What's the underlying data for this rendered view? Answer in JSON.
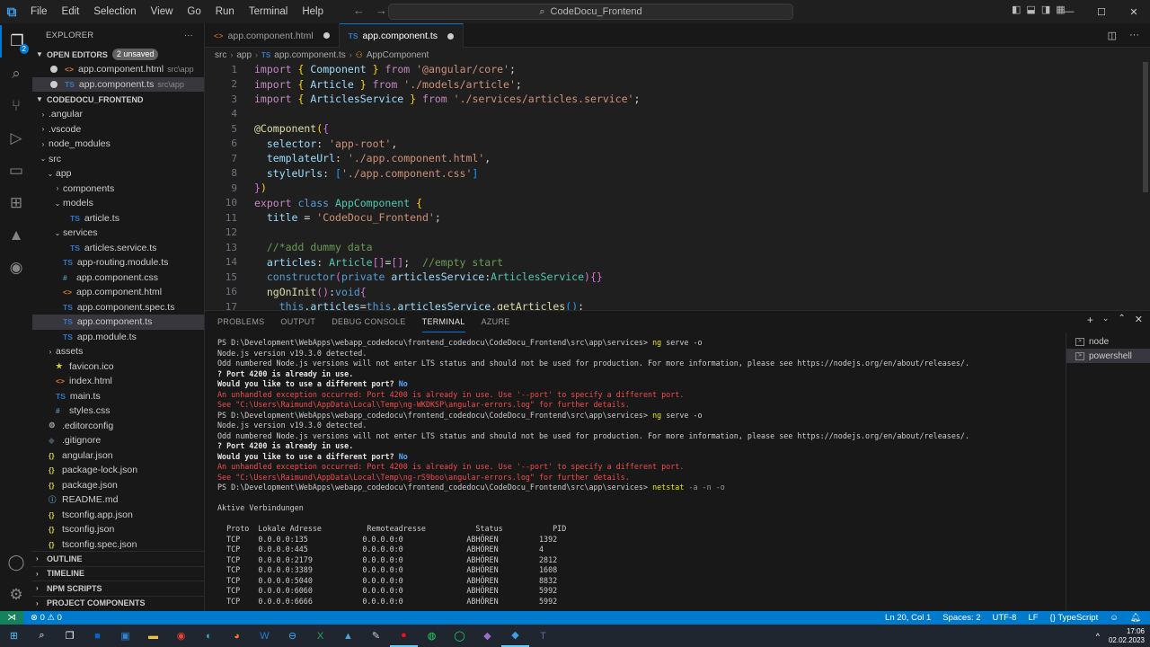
{
  "titlebar": {
    "menu": [
      "File",
      "Edit",
      "Selection",
      "View",
      "Go",
      "Run",
      "Terminal",
      "Help"
    ],
    "search": "CodeDocu_Frontend"
  },
  "explorer": {
    "title": "EXPLORER",
    "open_editors": {
      "label": "OPEN EDITORS",
      "badge": "2 unsaved",
      "items": [
        {
          "name": "app.component.html",
          "path": "src\\app",
          "icon": "html"
        },
        {
          "name": "app.component.ts",
          "path": "src\\app",
          "icon": "ts"
        }
      ]
    },
    "project": {
      "label": "CODEDOCU_FRONTEND",
      "tree": [
        {
          "name": ".angular",
          "depth": 0,
          "folder": true
        },
        {
          "name": ".vscode",
          "depth": 0,
          "folder": true
        },
        {
          "name": "node_modules",
          "depth": 0,
          "folder": true
        },
        {
          "name": "src",
          "depth": 0,
          "folder": true,
          "open": true
        },
        {
          "name": "app",
          "depth": 1,
          "folder": true,
          "open": true
        },
        {
          "name": "components",
          "depth": 2,
          "folder": true
        },
        {
          "name": "models",
          "depth": 2,
          "folder": true,
          "open": true
        },
        {
          "name": "article.ts",
          "depth": 3,
          "icon": "ts"
        },
        {
          "name": "services",
          "depth": 2,
          "folder": true,
          "open": true
        },
        {
          "name": "articles.service.ts",
          "depth": 3,
          "icon": "ts"
        },
        {
          "name": "app-routing.module.ts",
          "depth": 2,
          "icon": "ts"
        },
        {
          "name": "app.component.css",
          "depth": 2,
          "icon": "css"
        },
        {
          "name": "app.component.html",
          "depth": 2,
          "icon": "html"
        },
        {
          "name": "app.component.spec.ts",
          "depth": 2,
          "icon": "ts"
        },
        {
          "name": "app.component.ts",
          "depth": 2,
          "icon": "ts",
          "selected": true
        },
        {
          "name": "app.module.ts",
          "depth": 2,
          "icon": "ts"
        },
        {
          "name": "assets",
          "depth": 1,
          "folder": true
        },
        {
          "name": "favicon.ico",
          "depth": 1,
          "icon": "fav"
        },
        {
          "name": "index.html",
          "depth": 1,
          "icon": "html"
        },
        {
          "name": "main.ts",
          "depth": 1,
          "icon": "ts"
        },
        {
          "name": "styles.css",
          "depth": 1,
          "icon": "css"
        },
        {
          "name": ".editorconfig",
          "depth": 0,
          "icon": "cfg"
        },
        {
          "name": ".gitignore",
          "depth": 0,
          "icon": "git"
        },
        {
          "name": "angular.json",
          "depth": 0,
          "icon": "json"
        },
        {
          "name": "package-lock.json",
          "depth": 0,
          "icon": "json"
        },
        {
          "name": "package.json",
          "depth": 0,
          "icon": "json"
        },
        {
          "name": "README.md",
          "depth": 0,
          "icon": "md"
        },
        {
          "name": "tsconfig.app.json",
          "depth": 0,
          "icon": "json"
        },
        {
          "name": "tsconfig.json",
          "depth": 0,
          "icon": "json"
        },
        {
          "name": "tsconfig.spec.json",
          "depth": 0,
          "icon": "json"
        }
      ]
    },
    "bottom_sections": [
      "OUTLINE",
      "TIMELINE",
      "NPM SCRIPTS",
      "PROJECT COMPONENTS"
    ]
  },
  "tabs": [
    {
      "label": "app.component.html",
      "icon": "html",
      "active": false
    },
    {
      "label": "app.component.ts",
      "icon": "ts",
      "active": true
    }
  ],
  "breadcrumb": [
    "src",
    "app",
    "app.component.ts",
    "AppComponent"
  ],
  "code_lines": [
    "1",
    "2",
    "3",
    "4",
    "5",
    "6",
    "7",
    "8",
    "9",
    "10",
    "11",
    "12",
    "13",
    "14",
    "15",
    "16",
    "17"
  ],
  "code": {
    "l1": {
      "import": "import",
      "names": "Component",
      "from": "from",
      "str": "'@angular/core'"
    },
    "l2": {
      "import": "import",
      "names": "Article",
      "from": "from",
      "str": "'./models/article'"
    },
    "l3": {
      "import": "import",
      "names": "ArticlesService",
      "from": "from",
      "str": "'./services/articles.service'"
    },
    "l5": {
      "decorator": "@Component"
    },
    "l6": {
      "key": "selector",
      "str": "'app-root'"
    },
    "l7": {
      "key": "templateUrl",
      "str": "'./app.component.html'"
    },
    "l8": {
      "key": "styleUrls",
      "str": "'./app.component.css'"
    },
    "l10": {
      "export": "export",
      "class": "class",
      "name": "AppComponent"
    },
    "l11": {
      "key": "title",
      "str": "'CodeDocu_Frontend'"
    },
    "l13": {
      "comment": "//*add dummy data"
    },
    "l14": {
      "key": "articles",
      "type": "Article",
      "comment": "//empty start"
    },
    "l15": {
      "ctor": "constructor",
      "private": "private",
      "param": "articlesService",
      "type": "ArticlesService"
    },
    "l16": {
      "fn": "ngOnInit",
      "ret": "void"
    },
    "l17": {
      "this1": "this",
      "prop": "articles",
      "this2": "this",
      "svc": "articlesService",
      "call": "getArticles"
    }
  },
  "panel": {
    "tabs": [
      "PROBLEMS",
      "OUTPUT",
      "DEBUG CONSOLE",
      "TERMINAL",
      "AZURE"
    ],
    "active_tab": "TERMINAL",
    "terminals": [
      "node",
      "powershell"
    ]
  },
  "terminal": {
    "prompt": "PS D:\\Development\\WebApps\\webapp_codedocu\\frontend_codedocu\\CodeDocu_Frontend\\src\\app\\services>",
    "cmd_ng": "ng",
    "cmd_serve": "serve -o",
    "node_version": "Node.js version v19.3.0 detected.",
    "odd_warning": "Odd numbered Node.js versions will not enter LTS status and should not be used for production. For more information, please see https://nodejs.org/en/about/releases/.",
    "port_in_use": "? Port 4200 is already in use.",
    "different_port": "Would you like to use a different port?",
    "answer_no": "No",
    "exception": "An unhandled exception occurred: Port 4200 is already in use. Use '--port' to specify a different port.",
    "see_log1": "See \"C:\\Users\\Raimund\\AppData\\Local\\Temp\\ng-WKDKSP\\angular-errors.log\" for further details.",
    "see_log2": "See \"C:\\Users\\Raimund\\AppData\\Local\\Temp\\ng-rS9boo\\angular-errors.log\" for further details.",
    "cmd_netstat": "netstat",
    "netstat_args": "-a -n -o",
    "aktive": "Aktive Verbindungen",
    "table_header": "  Proto  Lokale Adresse          Remoteadresse           Status           PID",
    "table_rows": [
      "  TCP    0.0.0.0:135            0.0.0.0:0              ABHÖREN         1392",
      "  TCP    0.0.0.0:445            0.0.0.0:0              ABHÖREN         4",
      "  TCP    0.0.0.0:2179           0.0.0.0:0              ABHÖREN         2812",
      "  TCP    0.0.0.0:3389           0.0.0.0:0              ABHÖREN         1608",
      "  TCP    0.0.0.0:5040           0.0.0.0:0              ABHÖREN         8832",
      "  TCP    0.0.0.0:6060           0.0.0.0:0              ABHÖREN         5992",
      "  TCP    0.0.0.0:6666           0.0.0.0:0              ABHÖREN         5992"
    ]
  },
  "statusbar": {
    "errors": "⊗ 0 ⚠ 0",
    "position": "Ln 20, Col 1",
    "spaces": "Spaces: 2",
    "encoding": "UTF-8",
    "eol": "LF",
    "language": "{} TypeScript"
  },
  "clock": {
    "time": "17:06",
    "date": "02.02.2023"
  },
  "colors": {
    "accent": "#007acc",
    "error": "#f14c4c",
    "badge": "#0078d4"
  }
}
